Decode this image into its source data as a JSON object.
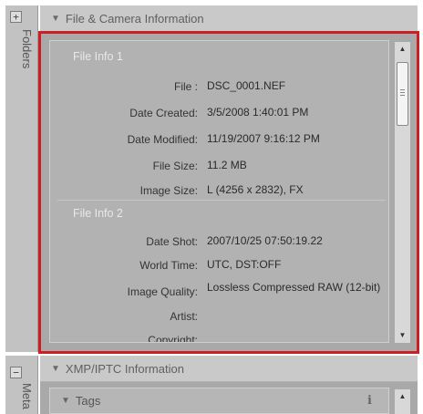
{
  "sidebar": {
    "top_label": "Folders",
    "top_button": "+",
    "bottom_label": "Meta",
    "bottom_button": "−"
  },
  "file_camera_section": {
    "title": "File & Camera Information",
    "groups": [
      {
        "title": "File Info 1",
        "rows": [
          {
            "label": "File :",
            "value": "DSC_0001.NEF"
          },
          {
            "label": "Date Created:",
            "value": "3/5/2008 1:40:01 PM"
          },
          {
            "label": "Date Modified:",
            "value": "11/19/2007 9:16:12 PM"
          },
          {
            "label": "File Size:",
            "value": "11.2 MB"
          },
          {
            "label": "Image Size:",
            "value": "L (4256 x 2832), FX"
          }
        ]
      },
      {
        "title": "File Info 2",
        "rows": [
          {
            "label": "Date Shot:",
            "value": "2007/10/25 07:50:19.22"
          },
          {
            "label": "World Time:",
            "value": "UTC, DST:OFF"
          },
          {
            "label": "Image Quality:",
            "value": "Lossless Compressed RAW (12-bit)"
          },
          {
            "label": "Artist:",
            "value": ""
          },
          {
            "label": "Copyright:",
            "value": ""
          }
        ]
      }
    ]
  },
  "xmp_section": {
    "title": "XMP/IPTC Information",
    "tags_label": "Tags",
    "info_icon_glyph": "i"
  },
  "colors": {
    "highlight_border": "#cc1f24",
    "panel_bg": "#a9a9a9"
  }
}
